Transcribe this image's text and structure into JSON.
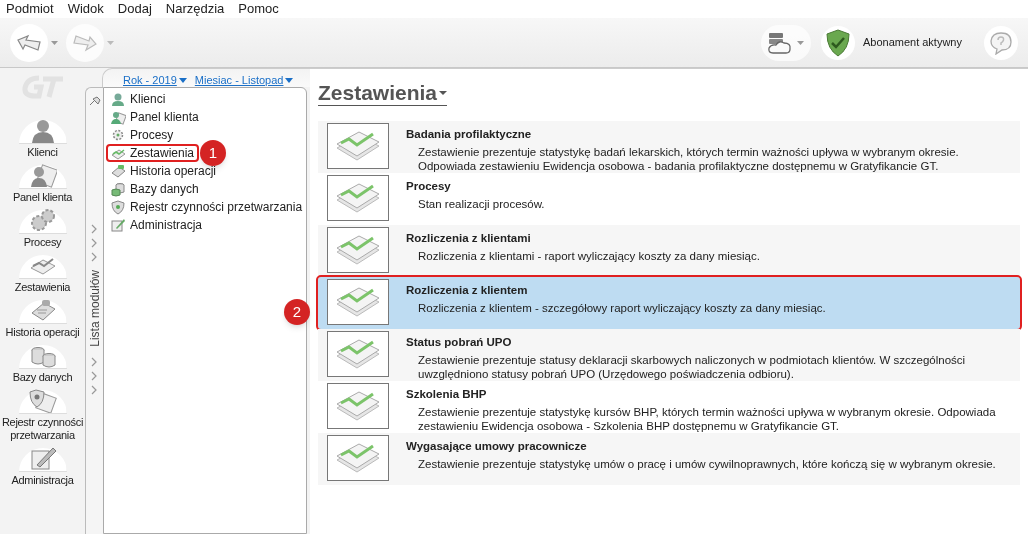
{
  "menu": [
    "Podmiot",
    "Widok",
    "Dodaj",
    "Narzędzia",
    "Pomoc"
  ],
  "toolbar": {
    "subscription": "Abonament aktywny"
  },
  "sidebar": {
    "items": [
      {
        "label": "Klienci"
      },
      {
        "label": "Panel klienta"
      },
      {
        "label": "Procesy"
      },
      {
        "label": "Zestawienia"
      },
      {
        "label": "Historia operacji"
      },
      {
        "label": "Bazy danych"
      },
      {
        "label": "Rejestr czynności przetwarzania"
      },
      {
        "label": "Administracja"
      }
    ]
  },
  "filters": [
    {
      "label": "Rok - 2019"
    },
    {
      "label": "Miesiac - Listopad"
    }
  ],
  "module_strip": {
    "label": "Lista modułów"
  },
  "modules": [
    {
      "label": "Klienci",
      "highlighted": false
    },
    {
      "label": "Panel klienta",
      "highlighted": false
    },
    {
      "label": "Procesy",
      "highlighted": false
    },
    {
      "label": "Zestawienia",
      "highlighted": true
    },
    {
      "label": "Historia operacji",
      "highlighted": false
    },
    {
      "label": "Bazy danych",
      "highlighted": false
    },
    {
      "label": "Rejestr czynności przetwarzania",
      "highlighted": false
    },
    {
      "label": "Administracja",
      "highlighted": false
    }
  ],
  "content": {
    "title": "Zestawienia",
    "reports": [
      {
        "title": "Badania profilaktyczne",
        "description": "Zestawienie prezentuje statystykę badań lekarskich, których termin ważności upływa w wybranym okresie. Odpowiada zestawieniu Ewidencja osobowa - badania profilaktyczne dostępnemu w Gratyfikancie GT.",
        "selected": false
      },
      {
        "title": "Procesy",
        "description": "Stan realizacji procesów.",
        "selected": false
      },
      {
        "title": "Rozliczenia z klientami",
        "description": "Rozliczenia z klientami - raport wyliczający koszty za dany miesiąc.",
        "selected": false
      },
      {
        "title": "Rozliczenia z klientem",
        "description": "Rozliczenia z klientem - szczegółowy raport wyliczający koszty za dany miesiąc.",
        "selected": true
      },
      {
        "title": "Status pobrań UPO",
        "description": "Zestawienie prezentuje statusy deklaracji skarbowych naliczonych w podmiotach klientów. W szczególności uwzględniono statusy pobrań UPO (Urzędowego poświadczenia odbioru).",
        "selected": false
      },
      {
        "title": "Szkolenia BHP",
        "description": "Zestawienie prezentuje statystykę kursów BHP, których termin ważności upływa w wybranym okresie. Odpowiada zestawieniu Ewidencja osobowa - Szkolenia BHP dostępnemu w Gratyfikancie GT.",
        "selected": false
      },
      {
        "title": "Wygasające umowy pracownicze",
        "description": "Zestawienie prezentuje statystykę umów o pracę i umów cywilnoprawnych, które kończą się w wybranym okresie.",
        "selected": false
      }
    ]
  },
  "annotations": [
    {
      "label": "1"
    },
    {
      "label": "2"
    }
  ]
}
